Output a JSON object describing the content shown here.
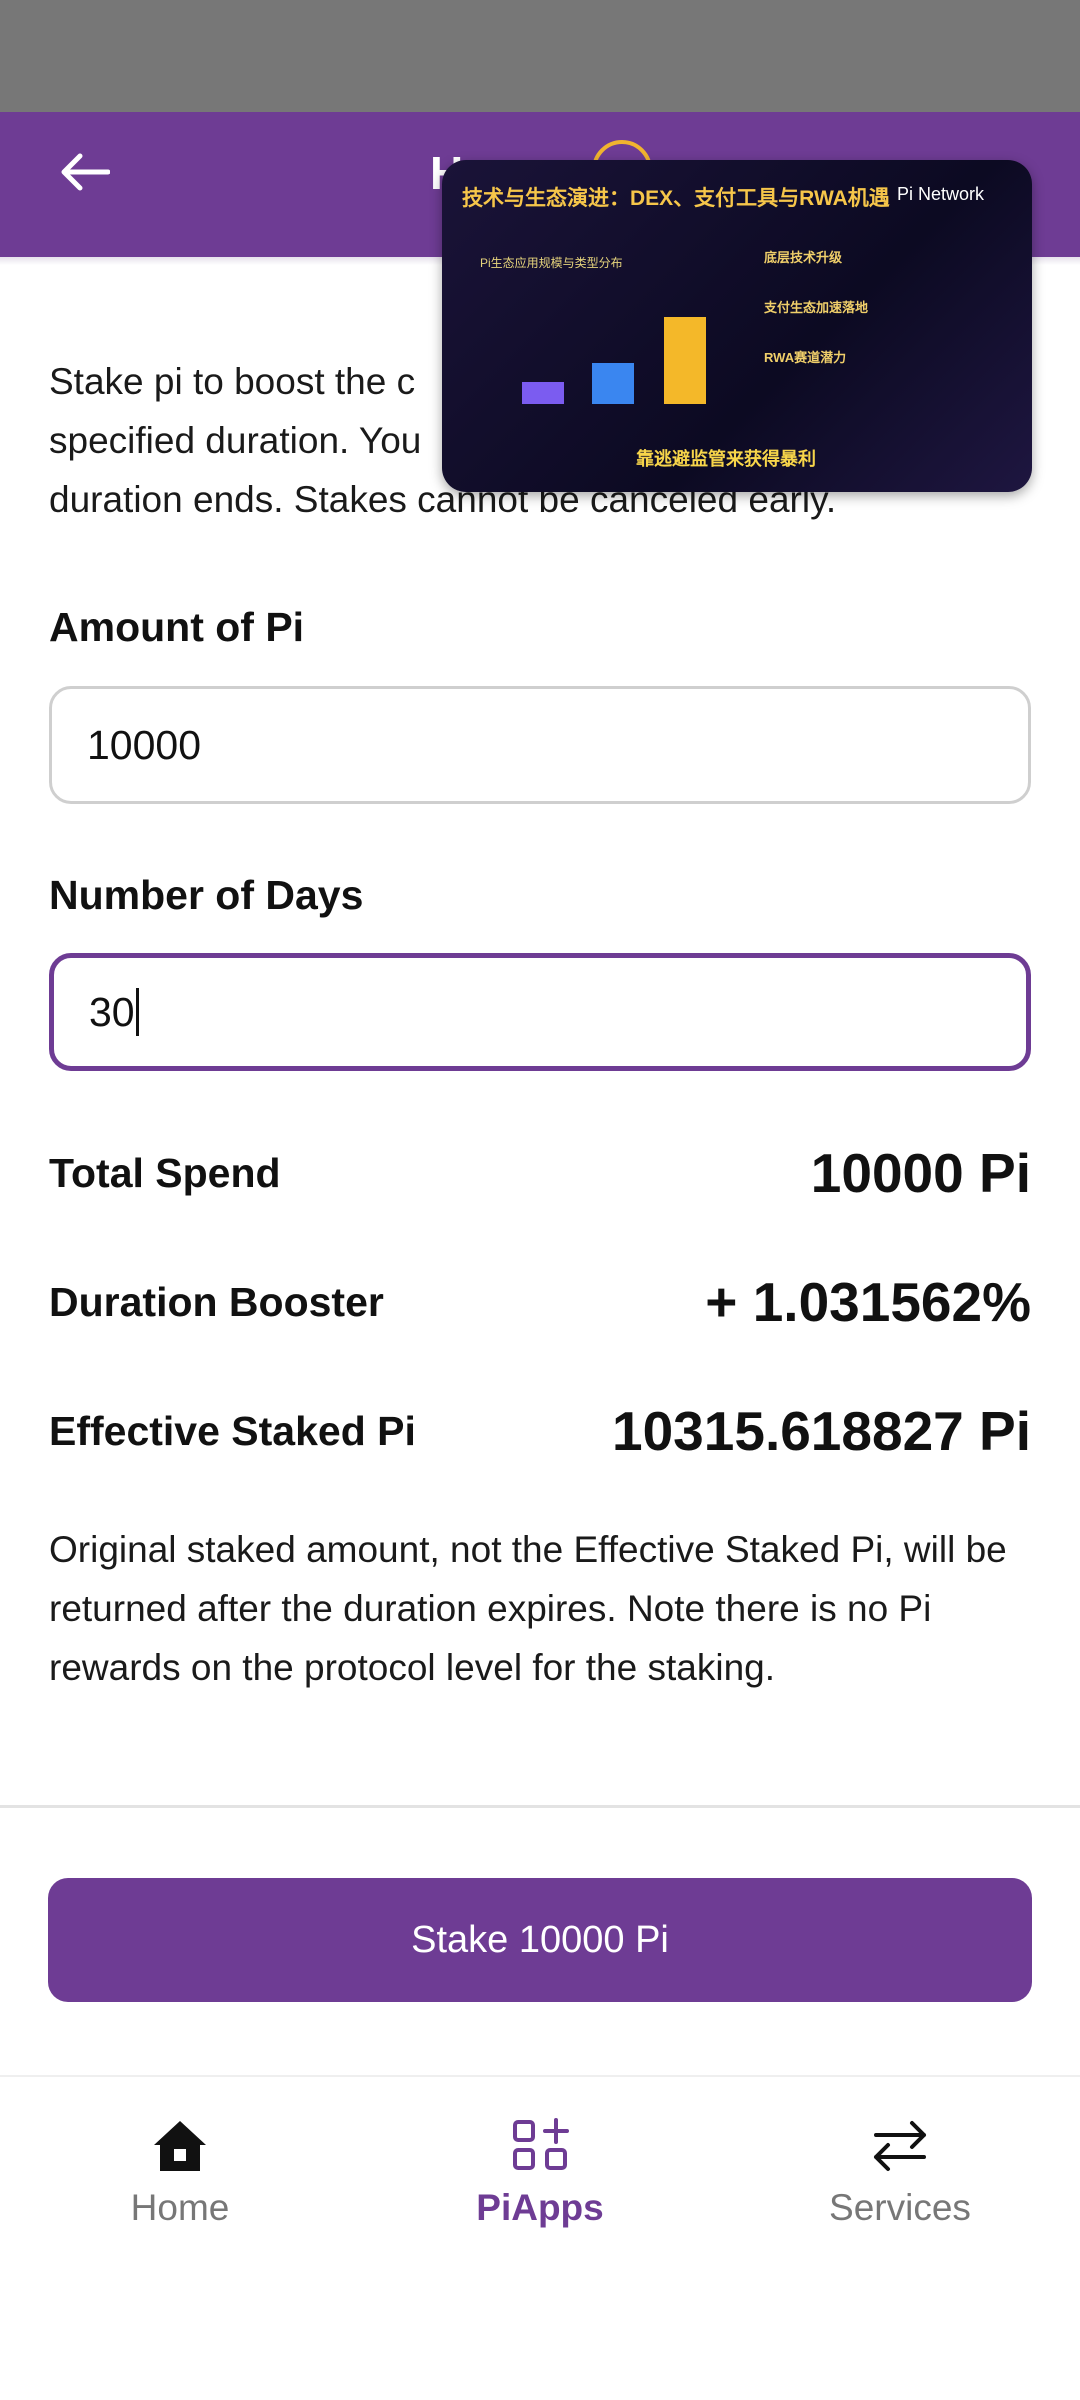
{
  "header": {
    "title": "H"
  },
  "intro": "Stake pi to boost the c... specified duration. You... duration ends. Stakes cannot be canceled early.",
  "intro_lines": [
    "Stake pi to boost the c",
    "specified duration. You",
    "duration ends. Stakes cannot be canceled early."
  ],
  "amount": {
    "label": "Amount of Pi",
    "value": "10000"
  },
  "days": {
    "label": "Number of Days",
    "value": "30"
  },
  "summary": {
    "total_spend_label": "Total Spend",
    "total_spend_value": "10000 Pi",
    "booster_label": "Duration Booster",
    "booster_value": "+ 1.031562%",
    "effective_label": "Effective Staked Pi",
    "effective_value": "10315.618827 Pi"
  },
  "note": "Original staked amount, not the Effective Staked Pi, will be returned after the duration expires. Note there is no Pi rewards on the protocol level for the staking.",
  "stake_button": "Stake 10000 Pi",
  "nav": [
    {
      "label": "Home",
      "icon": "home-icon"
    },
    {
      "label": "PiApps",
      "icon": "apps-icon"
    },
    {
      "label": "Services",
      "icon": "exchange-icon"
    }
  ],
  "video": {
    "title": "技术与生态演进：DEX、支付工具与RWA机遇",
    "brand": "Pi Network",
    "chart_title": "Pi生态应用规模与类型分布",
    "side_h1": "底层技术升级",
    "side_h2": "支付生态加速落地",
    "side_h3": "RWA赛道潜力",
    "subtitle": "靠逃避监管来获得暴利"
  },
  "colors": {
    "primary": "#6e3c94",
    "status_bar": "#777777",
    "video_accent": "#f6c64a"
  }
}
